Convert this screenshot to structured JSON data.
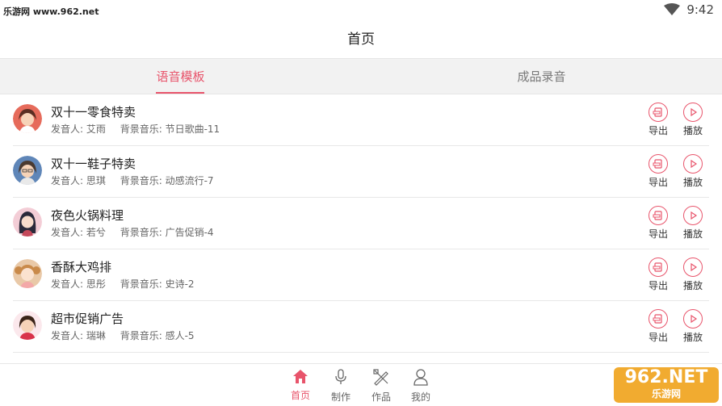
{
  "status_bar": {
    "watermark": "乐游网 www.962.net",
    "time": "9:42"
  },
  "header": {
    "title": "首页"
  },
  "tabs": [
    {
      "label": "语音模板",
      "active": true
    },
    {
      "label": "成品录音",
      "active": false
    }
  ],
  "list": {
    "speaker_prefix": "发音人:",
    "music_prefix": "背景音乐:",
    "export_label": "导出",
    "play_label": "播放",
    "items": [
      {
        "title": "双十一零食特卖",
        "speaker": "艾雨",
        "music": "节日歌曲-11",
        "avatar": "woman-avatar-icon"
      },
      {
        "title": "双十一鞋子特卖",
        "speaker": "思琪",
        "music": "动感流行-7",
        "avatar": "woman-glasses-avatar-icon"
      },
      {
        "title": "夜色火锅料理",
        "speaker": "若兮",
        "music": "广告促销-4",
        "avatar": "girl-longhair-avatar-icon"
      },
      {
        "title": "香酥大鸡排",
        "speaker": "思彤",
        "music": "史诗-2",
        "avatar": "girl-pigtails-avatar-icon"
      },
      {
        "title": "超市促销广告",
        "speaker": "瑞琳",
        "music": "感人-5",
        "avatar": "woman-shorthair-avatar-icon"
      }
    ]
  },
  "bottom_nav": [
    {
      "label": "首页",
      "icon": "home-icon",
      "active": true
    },
    {
      "label": "制作",
      "icon": "microphone-icon",
      "active": false
    },
    {
      "label": "作品",
      "icon": "tools-icon",
      "active": false
    },
    {
      "label": "我的",
      "icon": "user-icon",
      "active": false
    }
  ],
  "brand_logo": {
    "text": "962.NET",
    "subtext": "乐游网"
  },
  "colors": {
    "accent": "#e8546b",
    "tab_bar": "#f2f2f2"
  }
}
